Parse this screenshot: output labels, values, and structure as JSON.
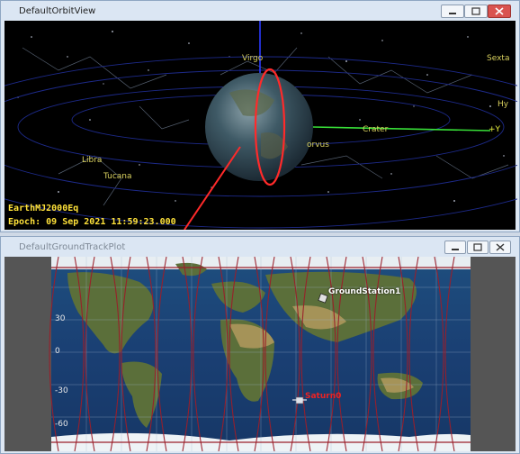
{
  "orbit_window": {
    "title": "DefaultOrbitView",
    "coord_label": "EarthMJ2000Eq",
    "epoch_label": "Epoch: 09 Sep 2021 11:59:23.000",
    "constellations": [
      "Virgo",
      "Sexta",
      "Hy",
      "Libra",
      "Tucana",
      "orvus",
      "Crater"
    ],
    "axis_label": "+Y"
  },
  "ground_window": {
    "title": "DefaultGroundTrackPlot",
    "lat_labels": [
      "30",
      "0",
      "-30",
      "-60"
    ],
    "ground_station_label": "GroundStation1",
    "sat_label": "Saturn0"
  },
  "window_buttons": [
    "minimize-button",
    "maximize-button",
    "close-button"
  ],
  "colors": {
    "orbit": "#ff2a2a",
    "y_axis": "#38e038",
    "z_axis": "#2a3bff",
    "track": "#9b1e2a",
    "label_yellow": "#ffe23a"
  }
}
